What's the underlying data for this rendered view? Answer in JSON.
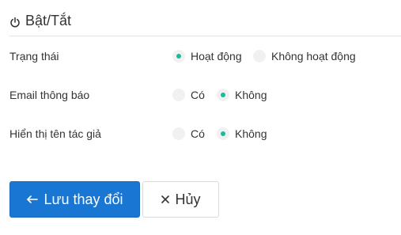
{
  "header": {
    "title": "Bật/Tắt",
    "icon": "power-icon"
  },
  "fields": {
    "status": {
      "label": "Trạng thái",
      "options": [
        {
          "label": "Hoạt động",
          "checked": true
        },
        {
          "label": "Không hoạt động",
          "checked": false
        }
      ]
    },
    "email_notify": {
      "label": "Email thông báo",
      "options": [
        {
          "label": "Có",
          "checked": false
        },
        {
          "label": "Không",
          "checked": true
        }
      ]
    },
    "show_author": {
      "label": "Hiển thị tên tác giả",
      "options": [
        {
          "label": "Có",
          "checked": false
        },
        {
          "label": "Không",
          "checked": true
        }
      ]
    }
  },
  "buttons": {
    "save": {
      "label": "Lưu thay đổi",
      "icon": "arrow-left-icon"
    },
    "cancel": {
      "label": "Hủy",
      "icon": "close-icon"
    }
  },
  "colors": {
    "primary": "#1976d2",
    "radio_dot": "#1abc9c",
    "radio_bg": "#f1f1f1",
    "divider": "#e3e3e3"
  }
}
